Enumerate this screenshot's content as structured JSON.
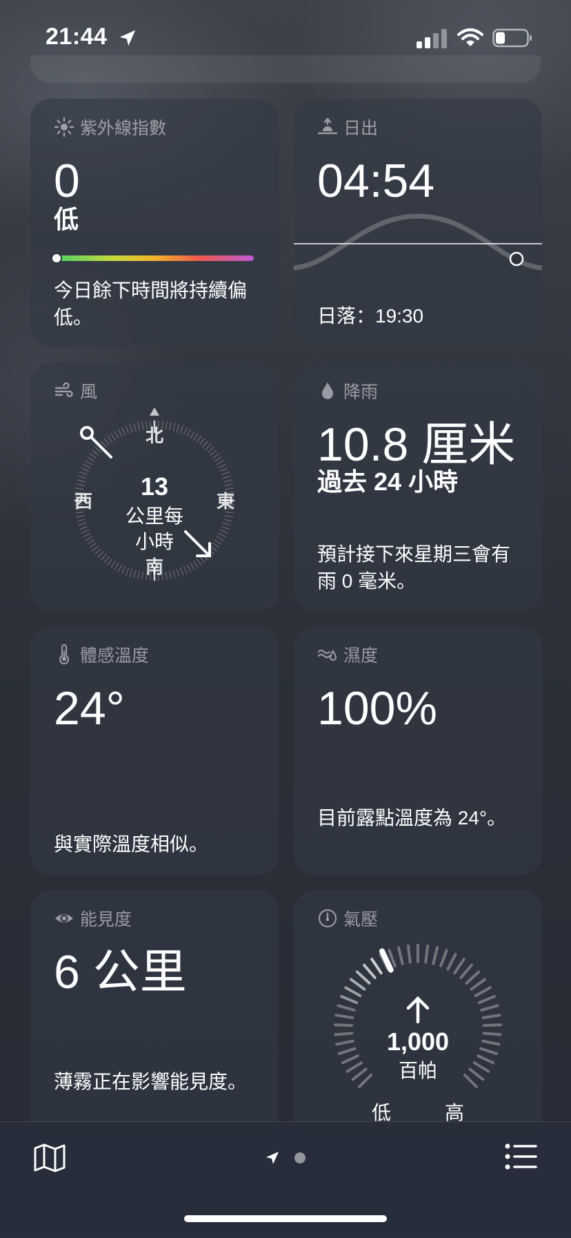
{
  "status_bar": {
    "time": "21:44"
  },
  "uv": {
    "title": "紫外線指數",
    "value": "0",
    "level": "低",
    "description": "今日餘下時間將持續偏低。",
    "position": 0
  },
  "sunrise": {
    "title": "日出",
    "time": "04:54",
    "sunset": "日落：19:30"
  },
  "wind": {
    "title": "風",
    "speed": "13",
    "unit_line1": "公里每",
    "unit_line2": "小時",
    "north": "北",
    "south": "南",
    "east": "東",
    "west": "西"
  },
  "rain": {
    "title": "降雨",
    "amount": "10.8 厘米",
    "period": "過去 24 小時",
    "description": "預計接下來星期三會有雨 0 毫米。"
  },
  "feels_like": {
    "title": "體感溫度",
    "value": "24°",
    "description": "與實際溫度相似。"
  },
  "humidity": {
    "title": "濕度",
    "value": "100%",
    "description": "目前露點溫度為 24°。"
  },
  "visibility": {
    "title": "能見度",
    "value": "6 公里",
    "description": "薄霧正在影響能見度。"
  },
  "pressure": {
    "title": "氣壓",
    "value": "1,000",
    "unit": "百帕",
    "low": "低",
    "high": "高"
  },
  "colors": {
    "accent": "#ffffff",
    "muted": "#8b909a"
  }
}
